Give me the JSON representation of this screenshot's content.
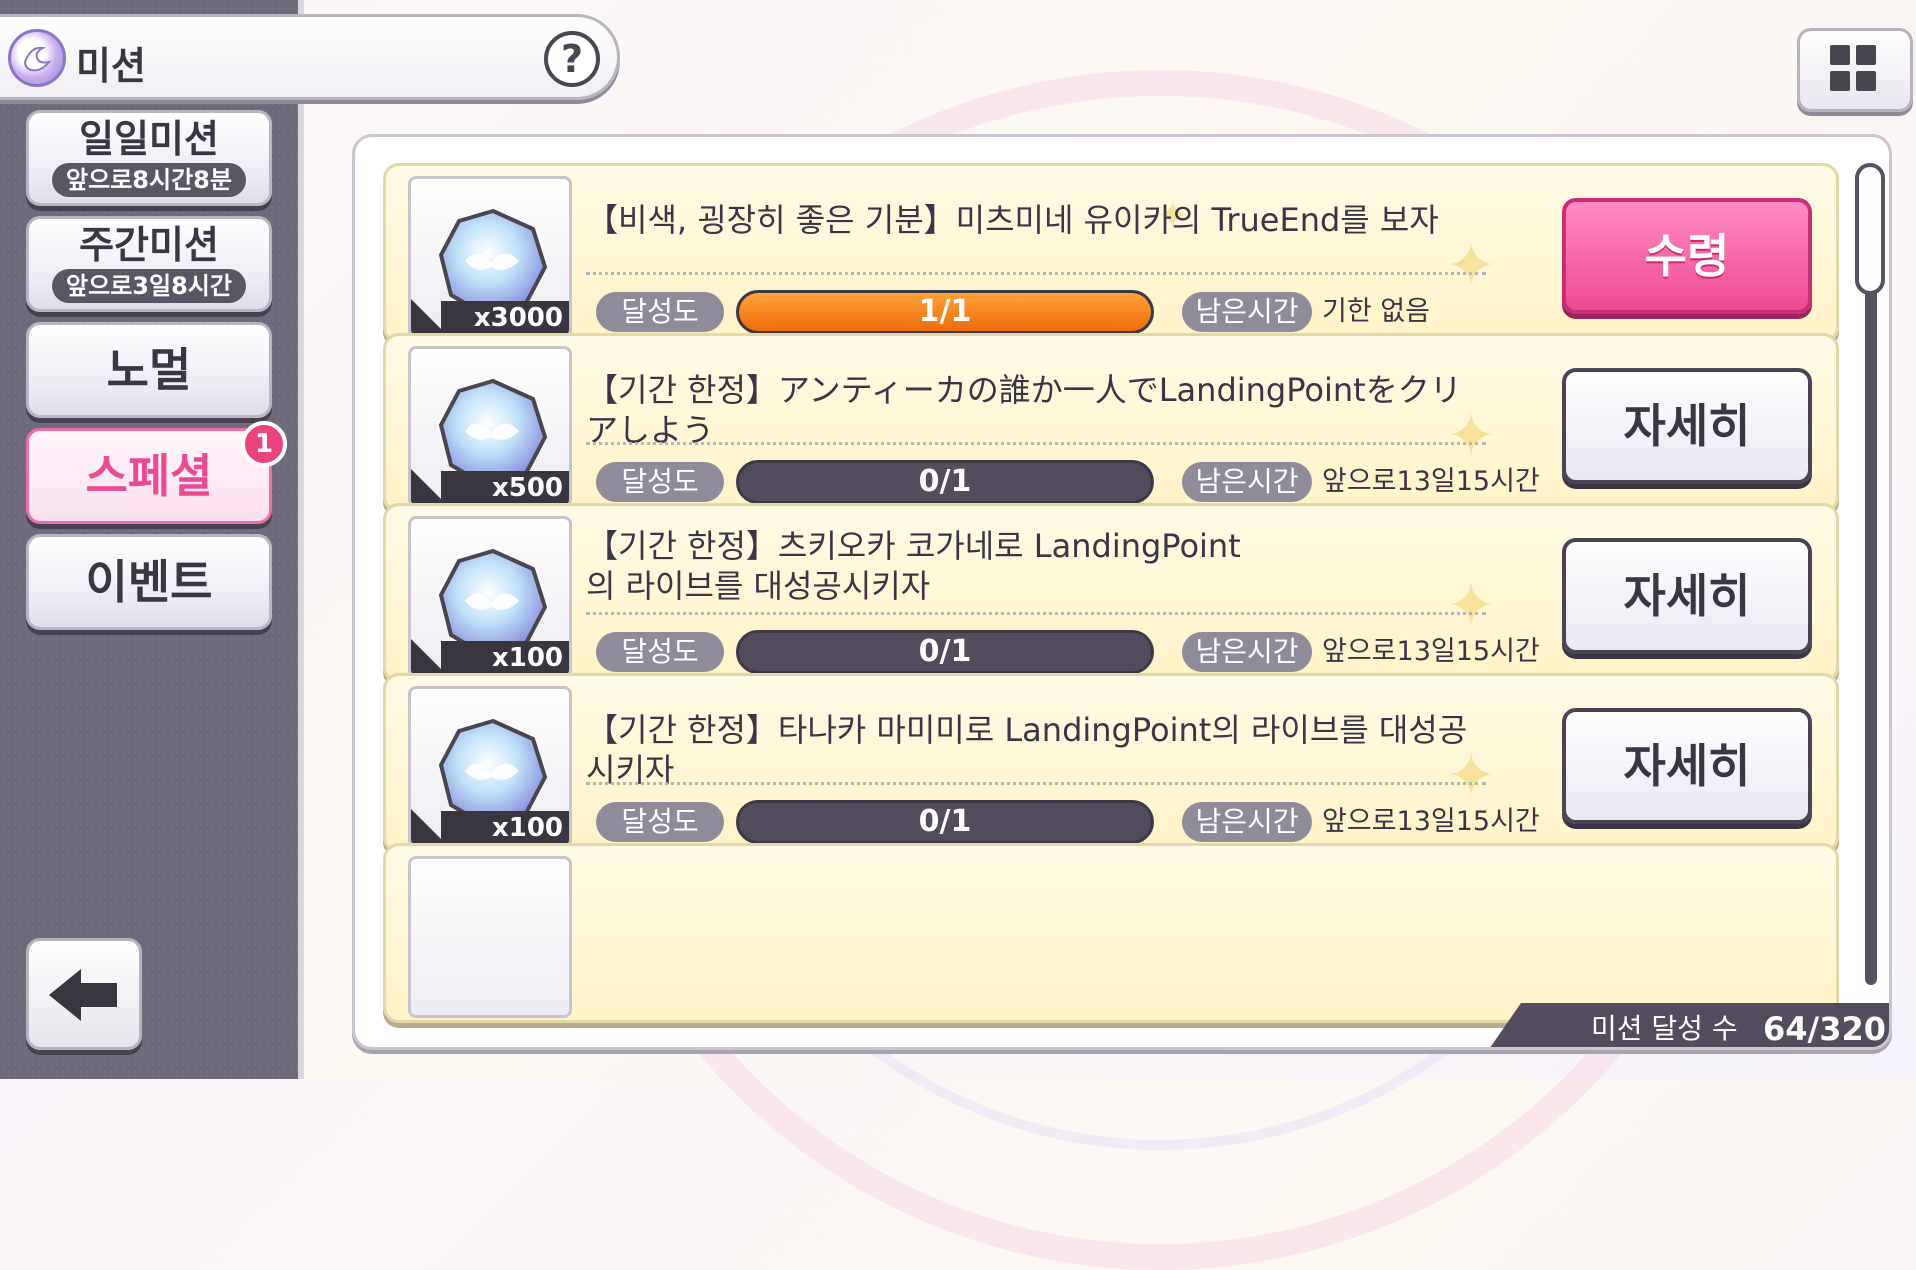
{
  "header": {
    "title": "미션",
    "help_label": "?"
  },
  "menu_icon": "grid-menu-icon",
  "sidebar": {
    "tabs": [
      {
        "label": "일일미션",
        "timer": "앞으로8시간8분",
        "active": false
      },
      {
        "label": "주간미션",
        "timer": "앞으로3일8시간",
        "active": false
      },
      {
        "label": "노멀",
        "active": false
      },
      {
        "label": "스페셜",
        "active": true,
        "badge": "1"
      },
      {
        "label": "이벤트",
        "active": false
      }
    ],
    "back_icon": "back-arrow-icon"
  },
  "labels": {
    "achievement": "달성도",
    "remaining": "남은시간"
  },
  "missions": [
    {
      "title": "【비색, 굉장히 좋은 기분】미츠미네 유이카의 TrueEnd를 보자",
      "reward_qty": "x3000",
      "progress_text": "1/1",
      "progress": 1.0,
      "remaining": "기한 없음",
      "action": "수령"
    },
    {
      "title": "【기간 한정】アンティーカの誰か一人でLandingPointをクリアしよう",
      "reward_qty": "x500",
      "progress_text": "0/1",
      "progress": 0,
      "remaining": "앞으로13일15시간",
      "action": "자세히"
    },
    {
      "title": "【기간 한정】츠키오카 코가네로 LandingPoint의 라이브를 대성공시키자",
      "reward_qty": "x100",
      "progress_text": "0/1",
      "progress": 0,
      "remaining": "앞으로13일15시간",
      "action": "자세히"
    },
    {
      "title": "【기간 한정】타나카 마미미로 LandingPoint의 라이브를 대성공시키자",
      "reward_qty": "x100",
      "progress_text": "0/1",
      "progress": 0,
      "remaining": "앞으로13일15시간",
      "action": "자세히"
    }
  ],
  "footer": {
    "count_label": "미션 달성 수",
    "count_value": "64/320"
  },
  "colors": {
    "accent_pink": "#ee4a93",
    "progress_orange": "#ff8a1f",
    "dark": "#524c5c",
    "card_bg": "#fff6d6"
  }
}
